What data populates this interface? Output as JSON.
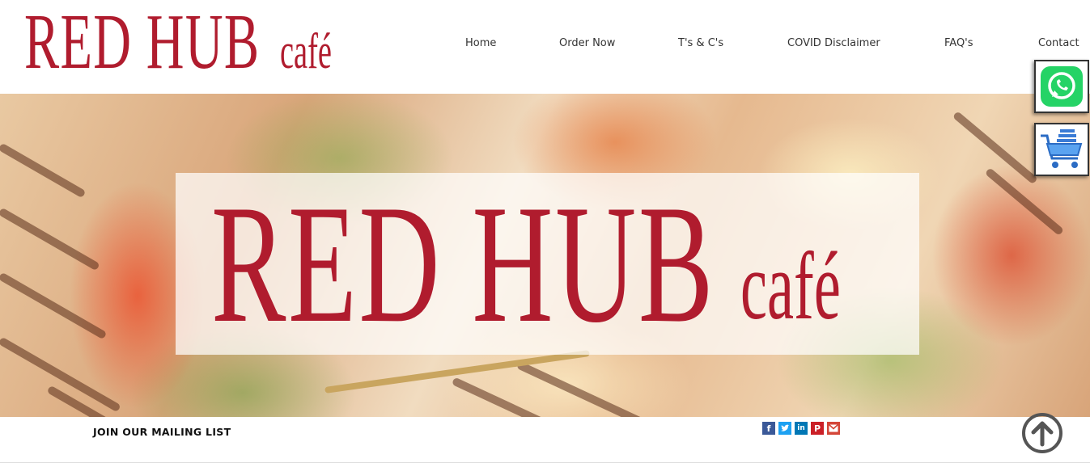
{
  "header": {
    "logo_main": "RED HUB",
    "logo_sub": "café"
  },
  "nav": {
    "items": [
      {
        "label": "Home"
      },
      {
        "label": "Order Now"
      },
      {
        "label": "T's & C's"
      },
      {
        "label": "COVID Disclaimer"
      },
      {
        "label": "FAQ's"
      },
      {
        "label": "Contact"
      }
    ]
  },
  "hero": {
    "logo_main": "RED HUB",
    "logo_sub": "café"
  },
  "floating": {
    "whatsapp_icon": "whatsapp-icon",
    "cart_icon": "shopping-cart-icon"
  },
  "footer": {
    "mailing_label": "JOIN OUR MAILING LIST",
    "social_icons": [
      "facebook-icon",
      "twitter-icon",
      "linkedin-icon",
      "pinterest-icon",
      "gmail-icon"
    ],
    "back_to_top_icon": "arrow-up-circle-icon"
  },
  "colors": {
    "brand_red": "#b01c2e",
    "whatsapp_green": "#25d366",
    "facebook": "#3b5998",
    "twitter": "#1da1f2",
    "linkedin": "#0077b5",
    "pinterest": "#cb2027",
    "gmail": "#d44638"
  }
}
